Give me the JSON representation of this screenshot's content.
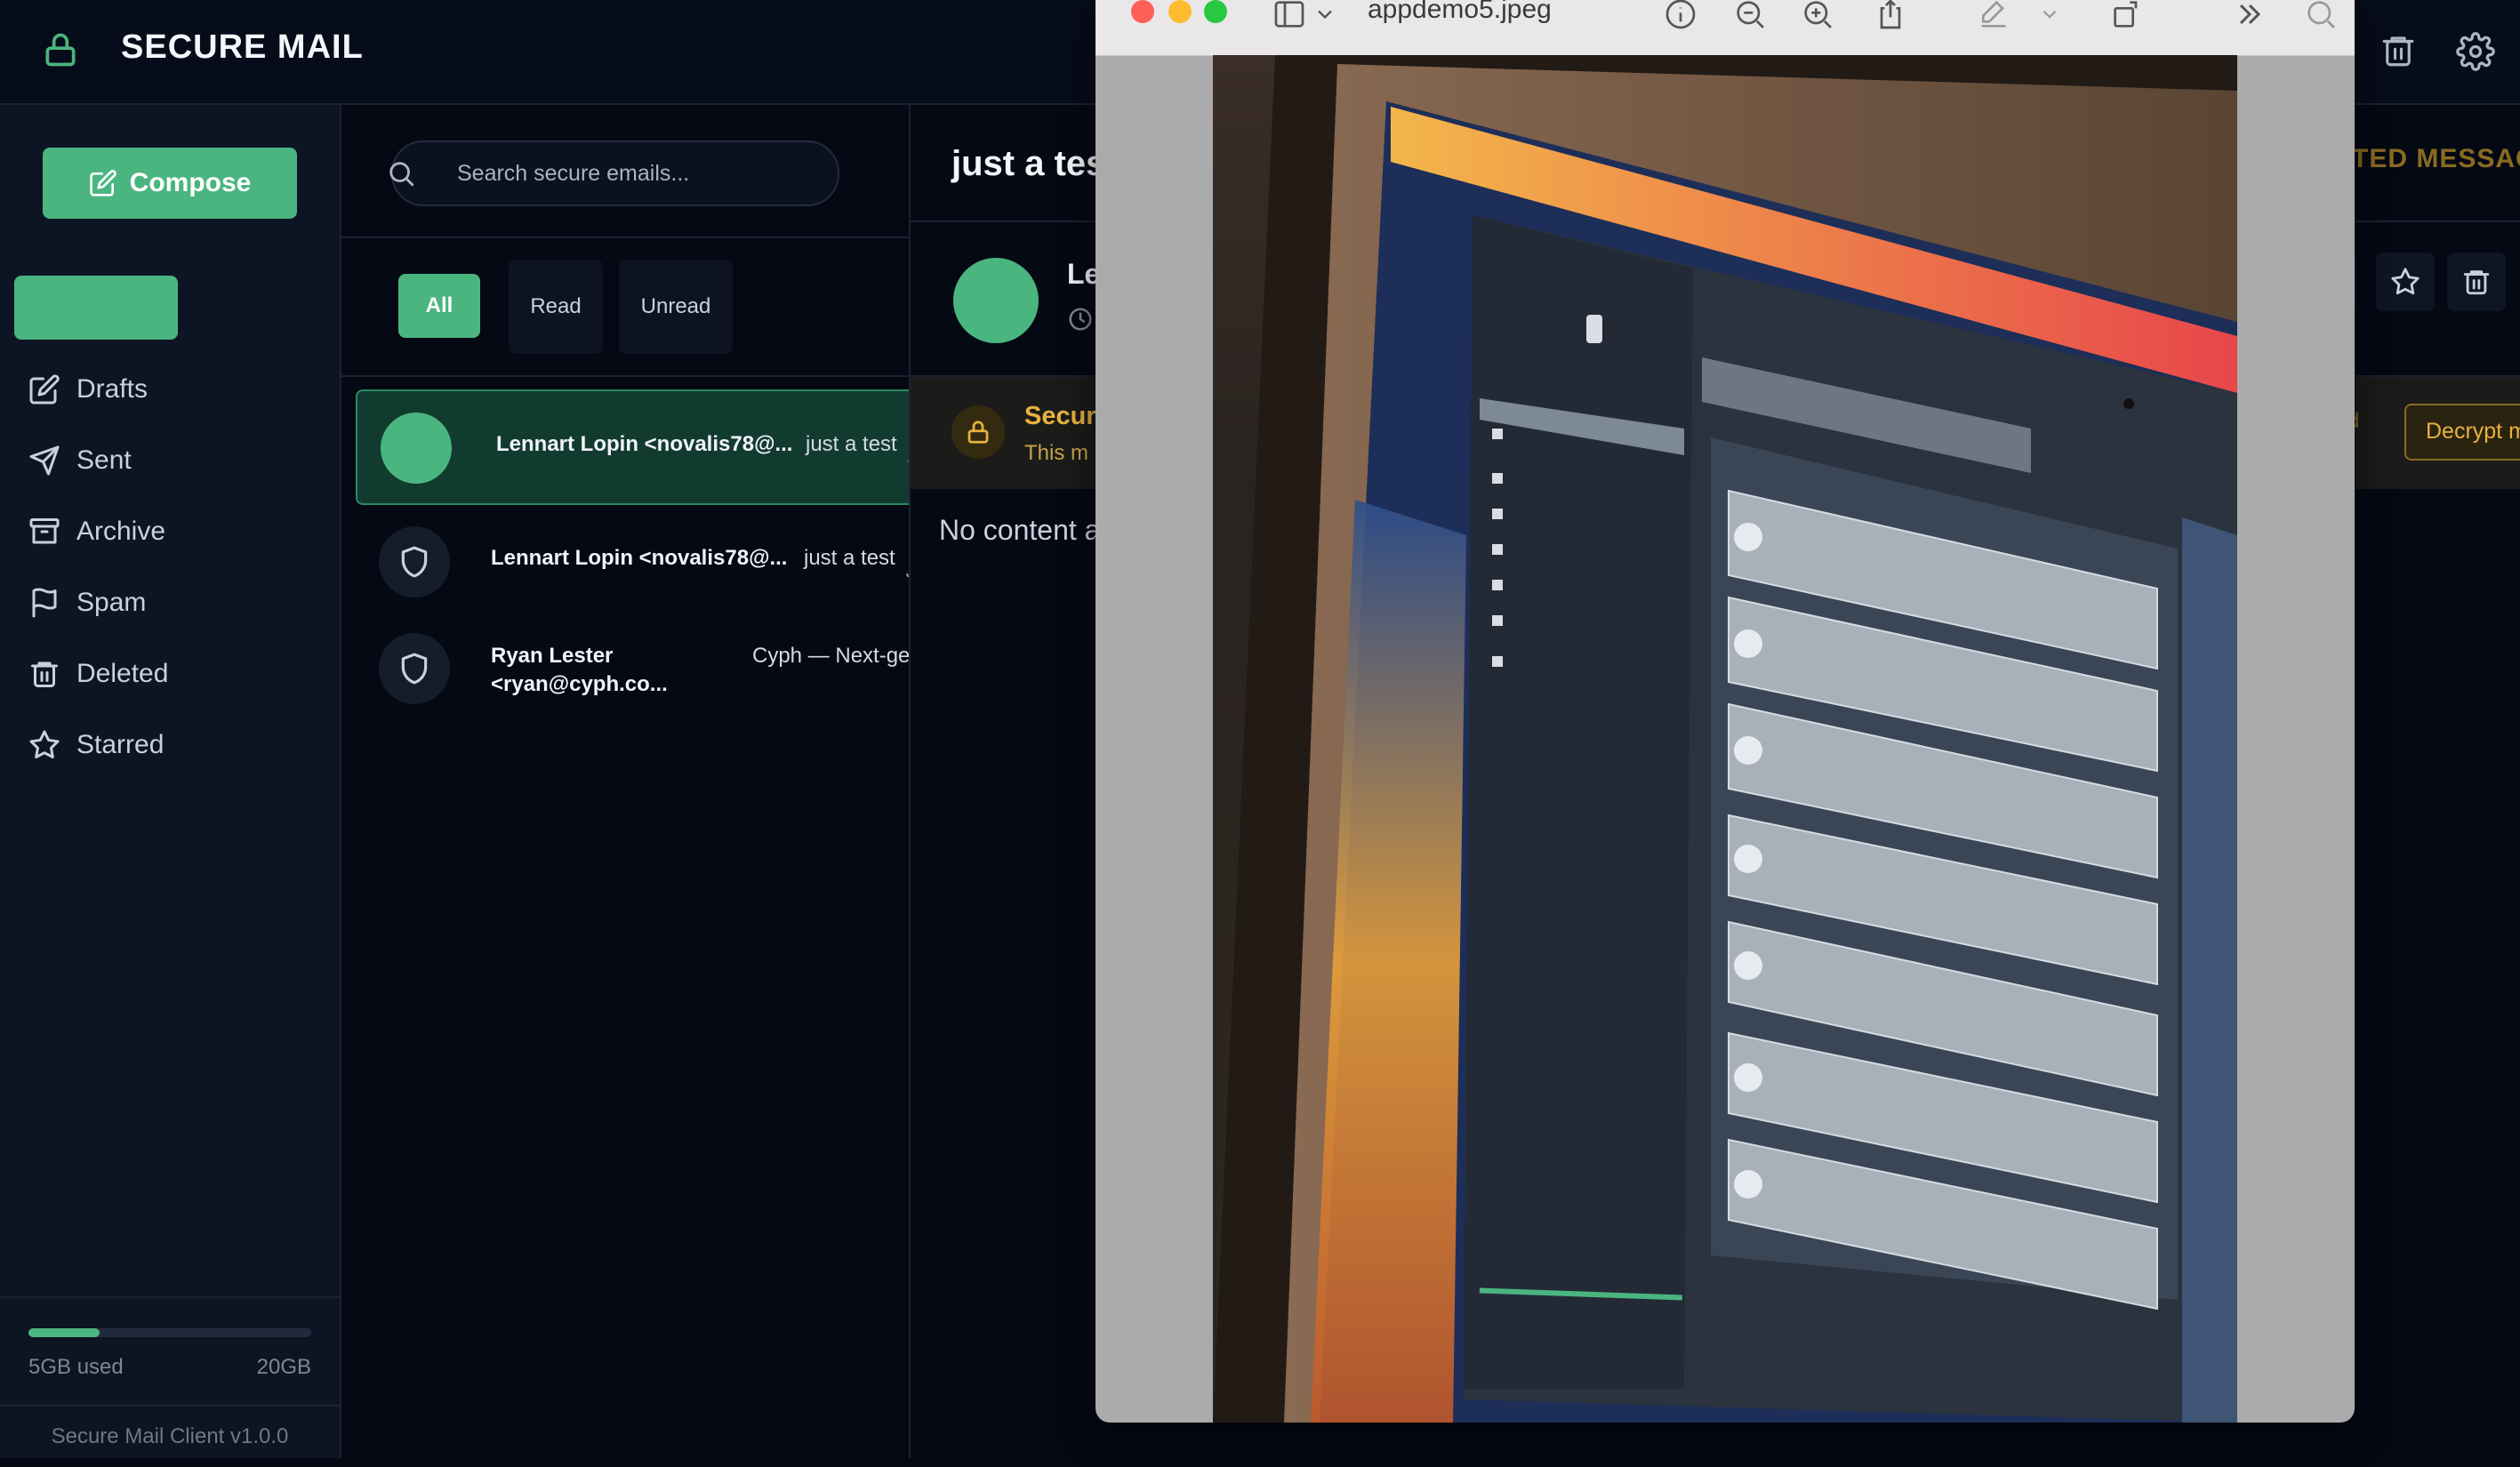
{
  "app": {
    "title": "SECURE MAIL",
    "icons": {
      "brand": "lock-icon",
      "delete": "trash-icon",
      "settings": "gear-icon"
    }
  },
  "colors": {
    "accent": "#4bb580",
    "background": "#050914",
    "sidebar": "#0d1424",
    "warning": "#e7b23e"
  },
  "sidebar": {
    "compose_label": "Compose",
    "items": [
      {
        "label": "Drafts",
        "icon": "edit-icon"
      },
      {
        "label": "Sent",
        "icon": "send-icon"
      },
      {
        "label": "Archive",
        "icon": "archive-icon"
      },
      {
        "label": "Spam",
        "icon": "flag-icon"
      },
      {
        "label": "Deleted",
        "icon": "trash-icon"
      },
      {
        "label": "Starred",
        "icon": "star-icon"
      }
    ],
    "storage": {
      "used": "5GB used",
      "total": "20GB",
      "fraction": 0.25
    },
    "version": "Secure Mail Client v1.0.0"
  },
  "list": {
    "search_placeholder": "Search secure emails...",
    "filters": [
      "All",
      "Read",
      "Unread"
    ],
    "active_filter": "All",
    "emails": [
      {
        "from": "Lennart Lopin <novalis78@...",
        "subject": "just a test",
        "selected": true,
        "avatar": "avatar"
      },
      {
        "from": "Lennart Lopin <novalis78@...",
        "subject": "just a test",
        "selected": false,
        "avatar": "shield-icon"
      },
      {
        "from_line1": "Ryan Lester",
        "from_line2": "<ryan@cyph.co...",
        "subject": "Cyph — Next-ger",
        "selected": false,
        "avatar": "shield-icon"
      }
    ]
  },
  "reader": {
    "title": "just a tes",
    "sender_name": "Le",
    "encrypted_label": "PTED MESSAG",
    "notice_title": "Secur",
    "notice_text": "This m",
    "notice_tag": "d",
    "decrypt_label": "Decrypt m",
    "body_text": "No content a"
  },
  "preview_window": {
    "filename": "appdemo5.jpeg",
    "toolbar_icons": [
      "sidebar-icon",
      "chevron-down-icon",
      "info-icon",
      "zoom-out-icon",
      "zoom-in-icon",
      "share-icon",
      "markup-icon",
      "chevron-down-icon",
      "rotate-icon",
      "more-icon",
      "search-icon"
    ],
    "photo_description": "photo-of-laptop-screen"
  }
}
